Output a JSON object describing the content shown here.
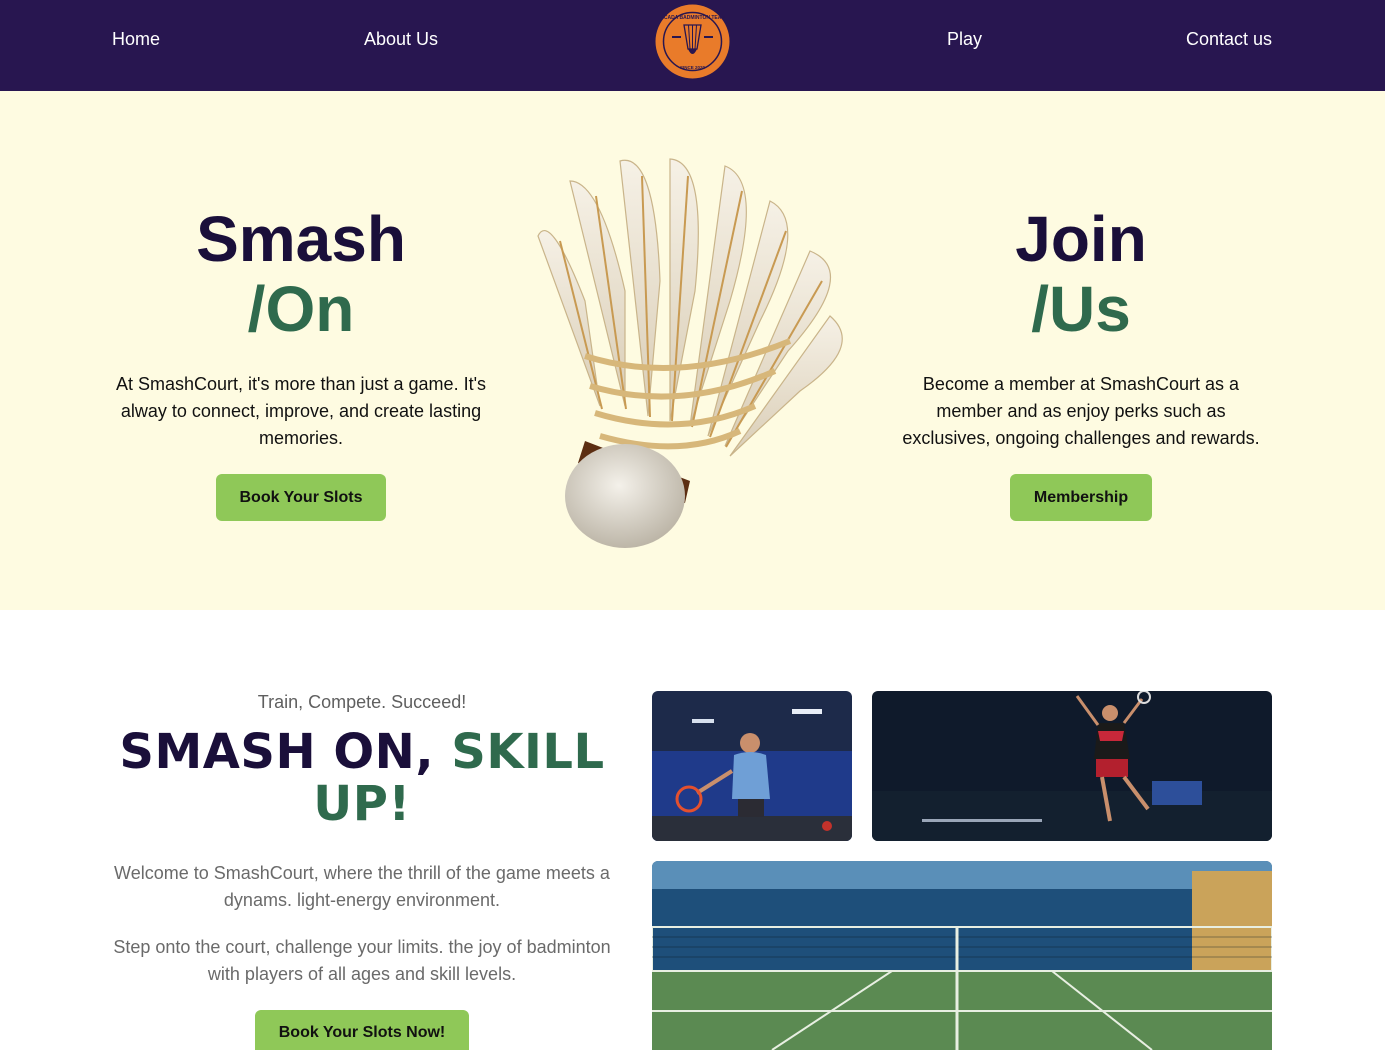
{
  "nav": {
    "home": "Home",
    "about": "About Us",
    "play": "Play",
    "contact": "Contact us",
    "logo_text_top": "LICADA BADMINTON TEAM",
    "logo_text_bottom": "SINCE 2020"
  },
  "hero": {
    "left": {
      "title": "Smash",
      "subtitle": "/On",
      "text": "At SmashCourt, it's more than just a game. It's alway to connect, improve, and create lasting memories.",
      "button": "Book Your Slots"
    },
    "right": {
      "title": "Join",
      "subtitle": "/Us",
      "text": "Become a member at SmashCourt as a member and as enjoy perks such as exclusives, ongoing challenges and rewards.",
      "button": "Membership"
    }
  },
  "intro": {
    "tagline": "Train, Compete. Succeed!",
    "heading_part1": "SMASH ON, ",
    "heading_part2": "SKILL UP!",
    "paragraph1": "Welcome to SmashCourt, where the thrill of the game meets a dynams. light-energy environment.",
    "paragraph2": "Step onto the court, challenge your limits. the joy of badminton with players of all ages and skill levels.",
    "button": "Book Your Slots Now!"
  },
  "colors": {
    "nav_bg": "#281650",
    "hero_bg": "#fefbe1",
    "heading_dark": "#1a0f3a",
    "heading_green": "#2f6a4d",
    "button_green": "#8fc858",
    "logo_orange": "#e97b2a"
  }
}
